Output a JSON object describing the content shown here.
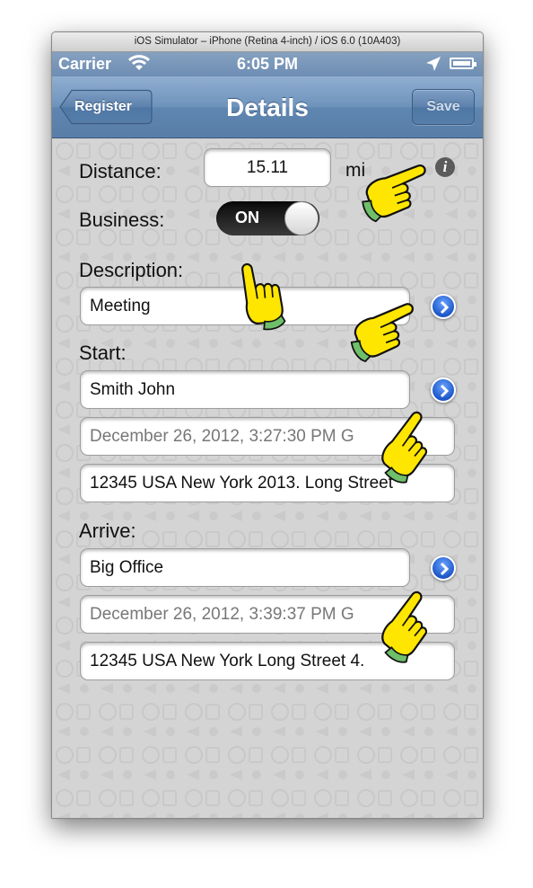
{
  "window": {
    "title": "iOS Simulator – iPhone (Retina 4-inch) / iOS 6.0 (10A403)"
  },
  "status_bar": {
    "carrier": "Carrier",
    "time": "6:05 PM"
  },
  "nav": {
    "title": "Details",
    "back_label": "Register",
    "save_label": "Save"
  },
  "form": {
    "distance_label": "Distance:",
    "distance_value": "15.11",
    "distance_unit": "mi",
    "business_label": "Business:",
    "business_toggle": "ON",
    "description_label": "Description:",
    "description_value": "Meeting",
    "start_label": "Start:",
    "start_name": "Smith John",
    "start_datetime": "December 26, 2012, 3:27:30 PM G",
    "start_address": "12345 USA New York 2013. Long Street",
    "arrive_label": "Arrive:",
    "arrive_name": "Big Office",
    "arrive_datetime": "December 26, 2012, 3:39:37 PM G",
    "arrive_address": "12345 USA New York Long Street 4."
  },
  "icons": {
    "wifi": "wifi-icon",
    "location": "location-arrow-icon",
    "battery": "battery-icon",
    "info": "info-icon",
    "disclosure": "disclosure-chevron-icon",
    "pointer": "pointing-hand-icon"
  },
  "colors": {
    "nav_bar": "#6e93bb",
    "disclosure": "#1d56c8",
    "background": "#d4d4d4"
  }
}
